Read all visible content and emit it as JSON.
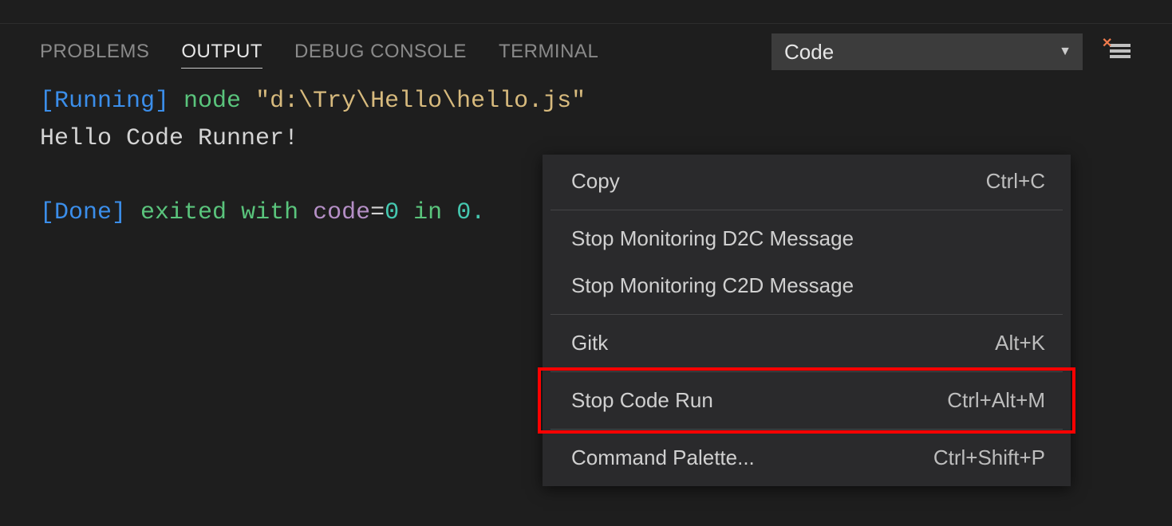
{
  "tabs": {
    "problems": "PROBLEMS",
    "output": "OUTPUT",
    "debug": "DEBUG CONSOLE",
    "terminal": "TERMINAL"
  },
  "channel_select": {
    "value": "Code"
  },
  "output": {
    "running_tag": "[Running]",
    "running_cmd1": "node",
    "running_cmd2": "\"d:\\Try\\Hello\\hello.js\"",
    "line2": "Hello Code Runner!",
    "done_tag": "[Done]",
    "done_txt1": "exited with",
    "done_code_key": "code",
    "done_eq": "=",
    "done_code_val": "0",
    "done_in": "in",
    "done_time": "0."
  },
  "context_menu": {
    "items": [
      {
        "label": "Copy",
        "shortcut": "Ctrl+C",
        "sep_after": true
      },
      {
        "label": "Stop Monitoring D2C Message",
        "shortcut": ""
      },
      {
        "label": "Stop Monitoring C2D Message",
        "shortcut": "",
        "sep_after": true
      },
      {
        "label": "Gitk",
        "shortcut": "Alt+K",
        "sep_after": true
      },
      {
        "label": "Stop Code Run",
        "shortcut": "Ctrl+Alt+M",
        "highlight": true,
        "sep_after": true
      },
      {
        "label": "Command Palette...",
        "shortcut": "Ctrl+Shift+P"
      }
    ]
  }
}
